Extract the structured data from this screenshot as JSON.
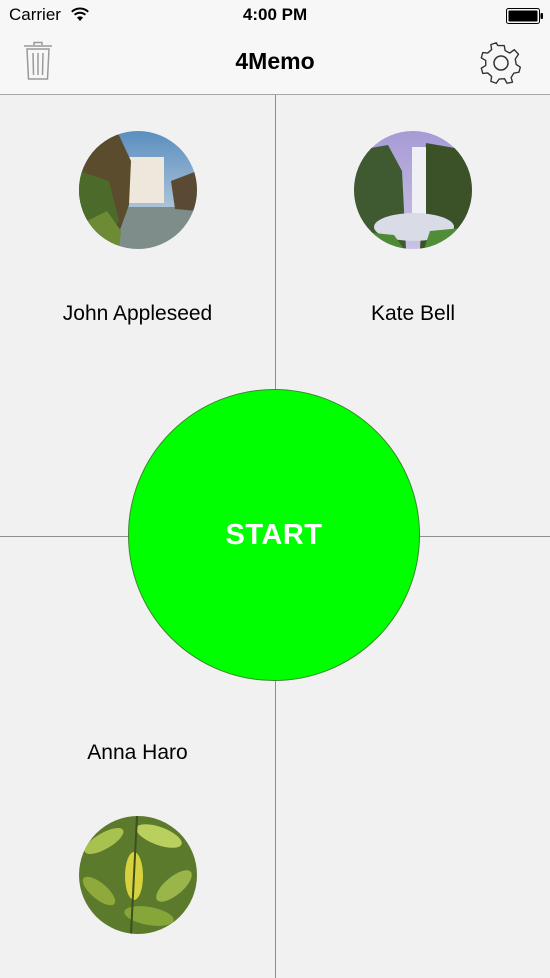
{
  "status_bar": {
    "carrier": "Carrier",
    "time": "4:00 PM",
    "wifi_icon": "wifi-icon",
    "battery_icon": "battery-full-icon"
  },
  "nav": {
    "title": "4Memo",
    "left_icon": "trash-icon",
    "right_icon": "gear-icon"
  },
  "contacts": [
    {
      "name": "John Appleseed",
      "photo": "waterfall-cliff-photo"
    },
    {
      "name": "Kate Bell",
      "photo": "misty-waterfall-photo"
    },
    {
      "name": "Anna Haro",
      "photo": "green-leaves-photo"
    }
  ],
  "start_button": {
    "label": "START",
    "color": "#00ff00"
  }
}
